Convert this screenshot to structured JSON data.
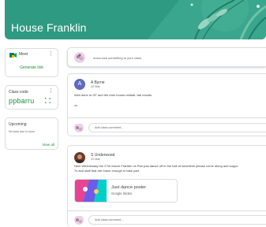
{
  "header": {
    "class_name": "House Franklin"
  },
  "sidebar": {
    "meet": {
      "title": "Meet",
      "link_label": "Generate link",
      "menu_glyph": "⋮"
    },
    "class_code": {
      "title": "Class code",
      "code": "ppbarru",
      "menu_glyph": "⋮"
    },
    "upcoming": {
      "title": "Upcoming",
      "empty_text": "No work due in soon",
      "view_all_label": "View all"
    }
  },
  "stream": {
    "announce_placeholder": "Announce something to your class",
    "posts": [
      {
        "author_initial": "A",
        "author": "A Byrne",
        "date": "22 Mar",
        "lines": [
          "Well done to GF and the inter house netball- fab results",
          "xx"
        ],
        "comment_placeholder": "Add class comment..."
      },
      {
        "author": "S Underwood",
        "date": "22 Mar",
        "lines": [
          "Next Wednesday the 27th march Franklin vs Parr just dance off in the hall at lunchtime please come along and suppo",
          "7s and staff that are brave enough to take part."
        ],
        "attachment": {
          "title": "Just dance poster",
          "type": "Google Slides"
        },
        "comment_placeholder": "Add class comment..."
      }
    ]
  },
  "colors": {
    "banner": "#2e9a82",
    "accent_green": "#1e8e3e",
    "avatar_a": "#5c6bc0"
  },
  "icons": [
    "meet-camera-icon",
    "more-vert-icon",
    "fullscreen-expand-icon",
    "user-avatar-icon"
  ]
}
